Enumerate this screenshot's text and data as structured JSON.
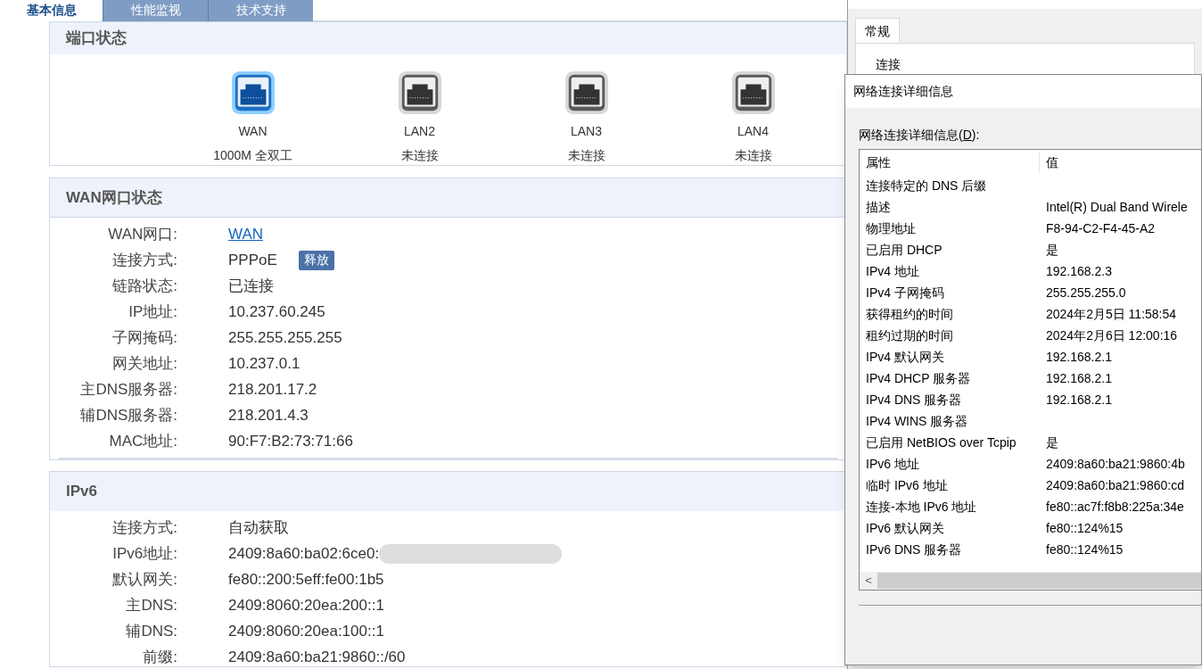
{
  "tabs": [
    {
      "label": "基本信息",
      "selected": true
    },
    {
      "label": "性能监视",
      "selected": false
    },
    {
      "label": "技术支持",
      "selected": false
    }
  ],
  "port_status": {
    "title": "端口状态",
    "ports": [
      {
        "name": "WAN",
        "status": "1000M 全双工",
        "connected": true
      },
      {
        "name": "LAN2",
        "status": "未连接",
        "connected": false
      },
      {
        "name": "LAN3",
        "status": "未连接",
        "connected": false
      },
      {
        "name": "LAN4",
        "status": "未连接",
        "connected": false
      }
    ]
  },
  "wan_status": {
    "title": "WAN网口状态",
    "rows": [
      {
        "label": "WAN网口:",
        "value": "WAN",
        "kind": "link"
      },
      {
        "label": "连接方式:",
        "value": "PPPoE",
        "kind": "button",
        "button": "释放"
      },
      {
        "label": "链路状态:",
        "value": "已连接",
        "kind": "text"
      },
      {
        "label": "IP地址:",
        "value": "10.237.60.245",
        "kind": "text"
      },
      {
        "label": "子网掩码:",
        "value": "255.255.255.255",
        "kind": "text"
      },
      {
        "label": "网关地址:",
        "value": "10.237.0.1",
        "kind": "text"
      },
      {
        "label": "主DNS服务器:",
        "value": "218.201.17.2",
        "kind": "text"
      },
      {
        "label": "辅DNS服务器:",
        "value": "218.201.4.3",
        "kind": "text"
      },
      {
        "label": "MAC地址:",
        "value": "90:F7:B2:73:71:66",
        "kind": "text"
      }
    ]
  },
  "ipv6": {
    "title": "IPv6",
    "rows": [
      {
        "label": "连接方式:",
        "value": "自动获取",
        "kind": "text"
      },
      {
        "label": "IPv6地址:",
        "value": "2409:8a60:ba02:6ce0:",
        "kind": "redacted"
      },
      {
        "label": "默认网关:",
        "value": "fe80::200:5eff:fe00:1b5",
        "kind": "text"
      },
      {
        "label": "主DNS:",
        "value": "2409:8060:20ea:200::1",
        "kind": "text"
      },
      {
        "label": "辅DNS:",
        "value": "2409:8060:20ea:100::1",
        "kind": "text"
      },
      {
        "label": "前缀:",
        "value": "2409:8a60:ba21:9860::/60",
        "kind": "text"
      }
    ]
  },
  "back_window": {
    "tab": "常规",
    "section": "连接"
  },
  "details_dialog": {
    "title": "网络连接详细信息",
    "label_before": "网络连接详细信息(",
    "access_key": "D",
    "label_after": "):",
    "columns": [
      "属性",
      "值"
    ],
    "rows": [
      [
        "连接特定的 DNS 后缀",
        ""
      ],
      [
        "描述",
        "Intel(R) Dual Band Wirele"
      ],
      [
        "物理地址",
        "F8-94-C2-F4-45-A2"
      ],
      [
        "已启用 DHCP",
        "是"
      ],
      [
        "IPv4 地址",
        "192.168.2.3"
      ],
      [
        "IPv4 子网掩码",
        "255.255.255.0"
      ],
      [
        "获得租约的时间",
        "2024年2月5日 11:58:54"
      ],
      [
        "租约过期的时间",
        "2024年2月6日 12:00:16"
      ],
      [
        "IPv4 默认网关",
        "192.168.2.1"
      ],
      [
        "IPv4 DHCP 服务器",
        "192.168.2.1"
      ],
      [
        "IPv4 DNS 服务器",
        "192.168.2.1"
      ],
      [
        "IPv4 WINS 服务器",
        ""
      ],
      [
        "已启用 NetBIOS over Tcpip",
        "是"
      ],
      [
        "IPv6 地址",
        "2409:8a60:ba21:9860:4b"
      ],
      [
        "临时 IPv6 地址",
        "2409:8a60:ba21:9860:cd"
      ],
      [
        "连接-本地 IPv6 地址",
        "fe80::ac7f:f8b8:225a:34e"
      ],
      [
        "IPv6 默认网关",
        "fe80::124%15"
      ],
      [
        "IPv6 DNS 服务器",
        "fe80::124%15"
      ]
    ],
    "scroll_left": "<"
  }
}
